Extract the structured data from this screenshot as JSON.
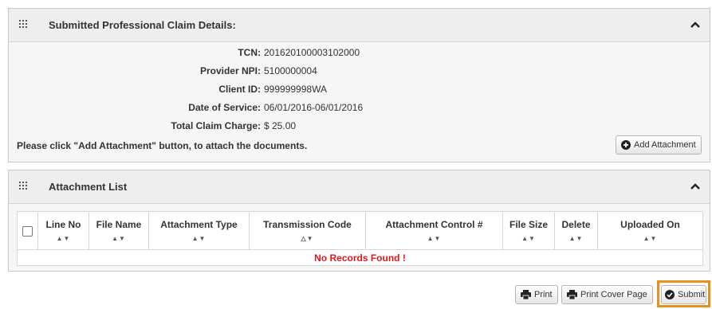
{
  "claim_panel": {
    "title": "Submitted Professional Claim Details:",
    "fields": [
      {
        "label": "TCN:",
        "value": "201620100003102000"
      },
      {
        "label": "Provider NPI:",
        "value": "5100000004"
      },
      {
        "label": "Client ID:",
        "value": "999999998WA"
      },
      {
        "label": "Date of Service:",
        "value": "06/01/2016-06/01/2016"
      },
      {
        "label": "Total Claim Charge:",
        "value": "$ 25.00"
      }
    ],
    "hint": "Please click \"Add Attachment\" button, to attach the documents.",
    "add_attachment_label": "Add Attachment"
  },
  "attach_panel": {
    "title": "Attachment List",
    "columns": [
      "Line No",
      "File Name",
      "Attachment Type",
      "Transmission Code",
      "Attachment Control #",
      "File Size",
      "Delete",
      "Uploaded On"
    ],
    "sort_glyphs": {
      "normal": "▲▼",
      "transmission": "△▼"
    },
    "empty_message": "No Records Found !"
  },
  "footer": {
    "print_label": "Print",
    "print_cover_label": "Print Cover Page",
    "submit_label": "Submit"
  },
  "colors": {
    "accent_highlight": "#e8921e",
    "no_records": "#e0171e"
  },
  "icons": {
    "grip": "grid-dots-icon",
    "collapse": "chevron-up-icon",
    "add": "plus-circle-icon",
    "print": "printer-icon",
    "submit": "check-circle-icon"
  }
}
